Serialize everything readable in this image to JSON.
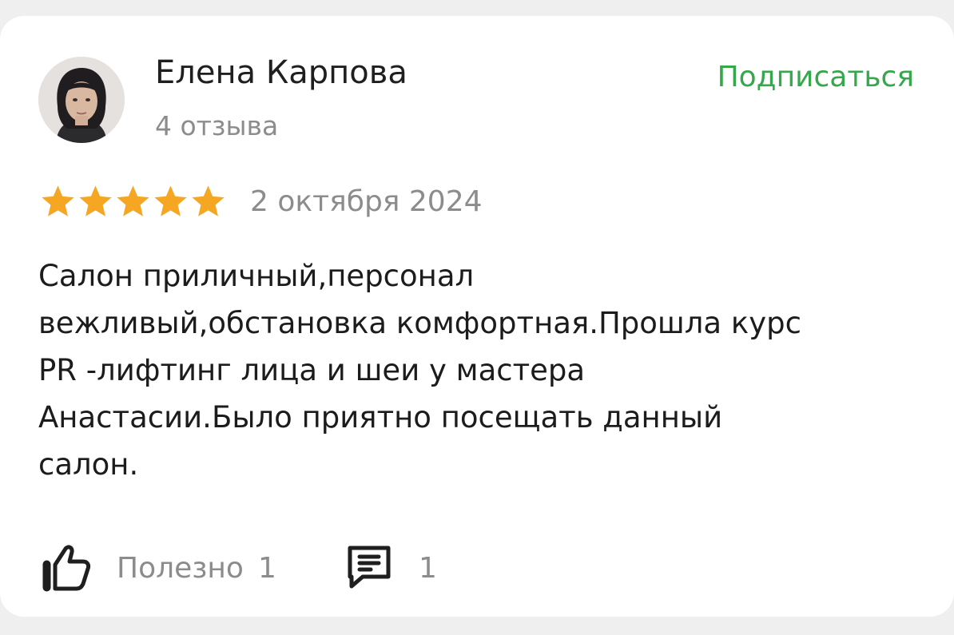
{
  "author": {
    "name": "Елена Карпова",
    "reviews_count": "4 отзыва"
  },
  "subscribe_label": "Подписаться",
  "rating": {
    "stars": 5,
    "max": 5,
    "color": "#f5a623"
  },
  "date": "2 октября 2024",
  "review_lines": [
    "Салон приличный,персонал",
    "вежливый,обстановка комфортная.Прошла курс",
    "PR -лифтинг лица и шеи у мастера",
    "Анастасии.Было приятно посещать данный",
    "салон."
  ],
  "actions": {
    "helpful_label": "Полезно",
    "helpful_count": "1",
    "comments_count": "1"
  },
  "icons": {
    "like": "thumbs-up-icon",
    "comment": "comment-icon"
  },
  "colors": {
    "accent": "#34a84a",
    "muted": "#8c8c8c"
  }
}
